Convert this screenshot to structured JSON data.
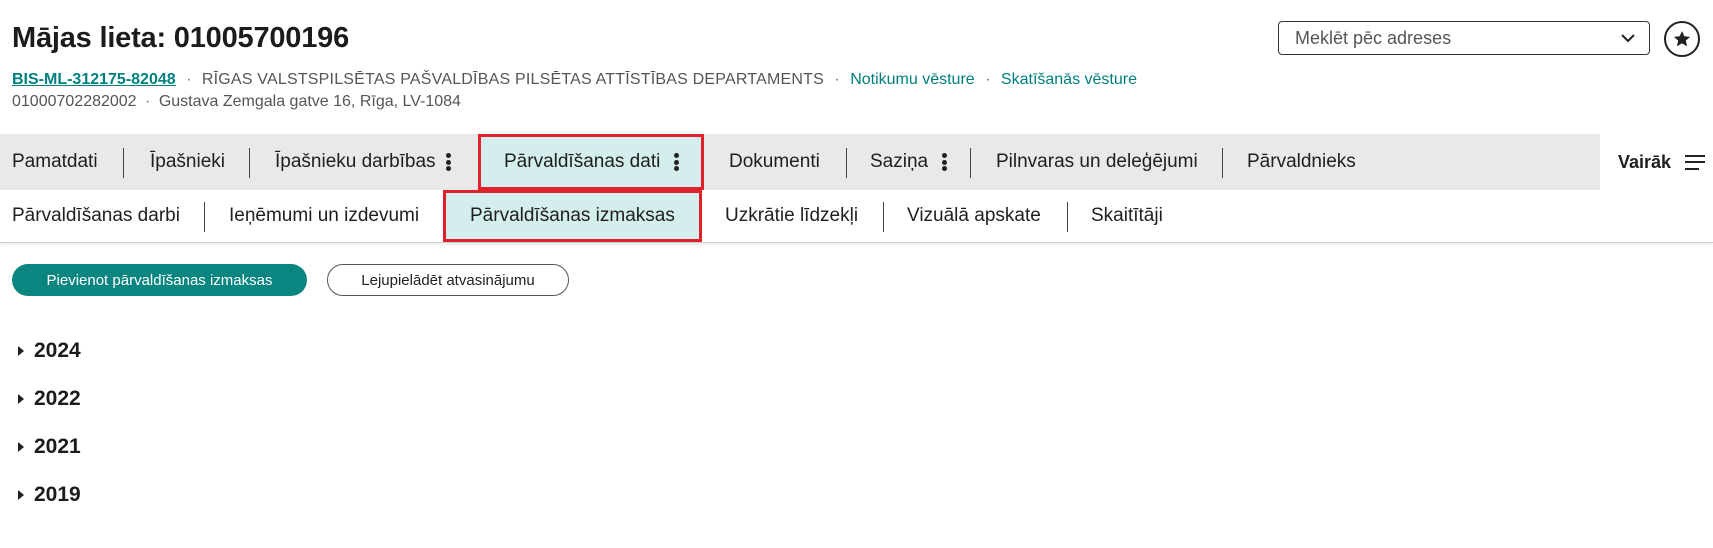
{
  "header": {
    "title": "Mājas lieta: 01005700196",
    "case_code": "BIS-ML-312175-82048",
    "separator": "·",
    "department": "RĪGAS VALSTSPILSĒTAS PAŠVALDĪBAS PILSĒTAS ATTĪSTĪBAS DEPARTAMENTS",
    "event_history_link": "Notikumu vēsture",
    "view_history_link": "Skatīšanās vēsture",
    "cadastre_number": "01000702282002",
    "address": "Gustava Zemgala gatve 16, Rīga, LV-1084"
  },
  "search": {
    "placeholder": "Meklēt pēc adreses"
  },
  "main_tabs": [
    {
      "label": "Pamatdati"
    },
    {
      "label": "Īpašnieki"
    },
    {
      "label": "Īpašnieku darbības"
    },
    {
      "label": "Pārvaldīšanas dati"
    },
    {
      "label": "Dokumenti"
    },
    {
      "label": "Saziņa"
    },
    {
      "label": "Pilnvaras un deleģējumi"
    },
    {
      "label": "Pārvaldnieks"
    }
  ],
  "more_label": "Vairāk",
  "sub_tabs": [
    {
      "label": "Pārvaldīšanas darbi"
    },
    {
      "label": "Ieņēmumi un izdevumi"
    },
    {
      "label": "Pārvaldīšanas izmaksas"
    },
    {
      "label": "Uzkrātie līdzekļi"
    },
    {
      "label": "Vizuālā apskate"
    },
    {
      "label": "Skaitītāji"
    }
  ],
  "actions": {
    "add_costs": "Pievienot pārvaldīšanas izmaksas",
    "download_statement": "Lejupielādēt atvasinājumu"
  },
  "years": [
    {
      "label": "2024"
    },
    {
      "label": "2022"
    },
    {
      "label": "2021"
    },
    {
      "label": "2019"
    }
  ],
  "colors": {
    "accent": "#0a8580",
    "active_tab_bg": "#d3eeed",
    "highlight_border": "#e0202a",
    "tab_bar_bg": "#e9e9e9"
  }
}
